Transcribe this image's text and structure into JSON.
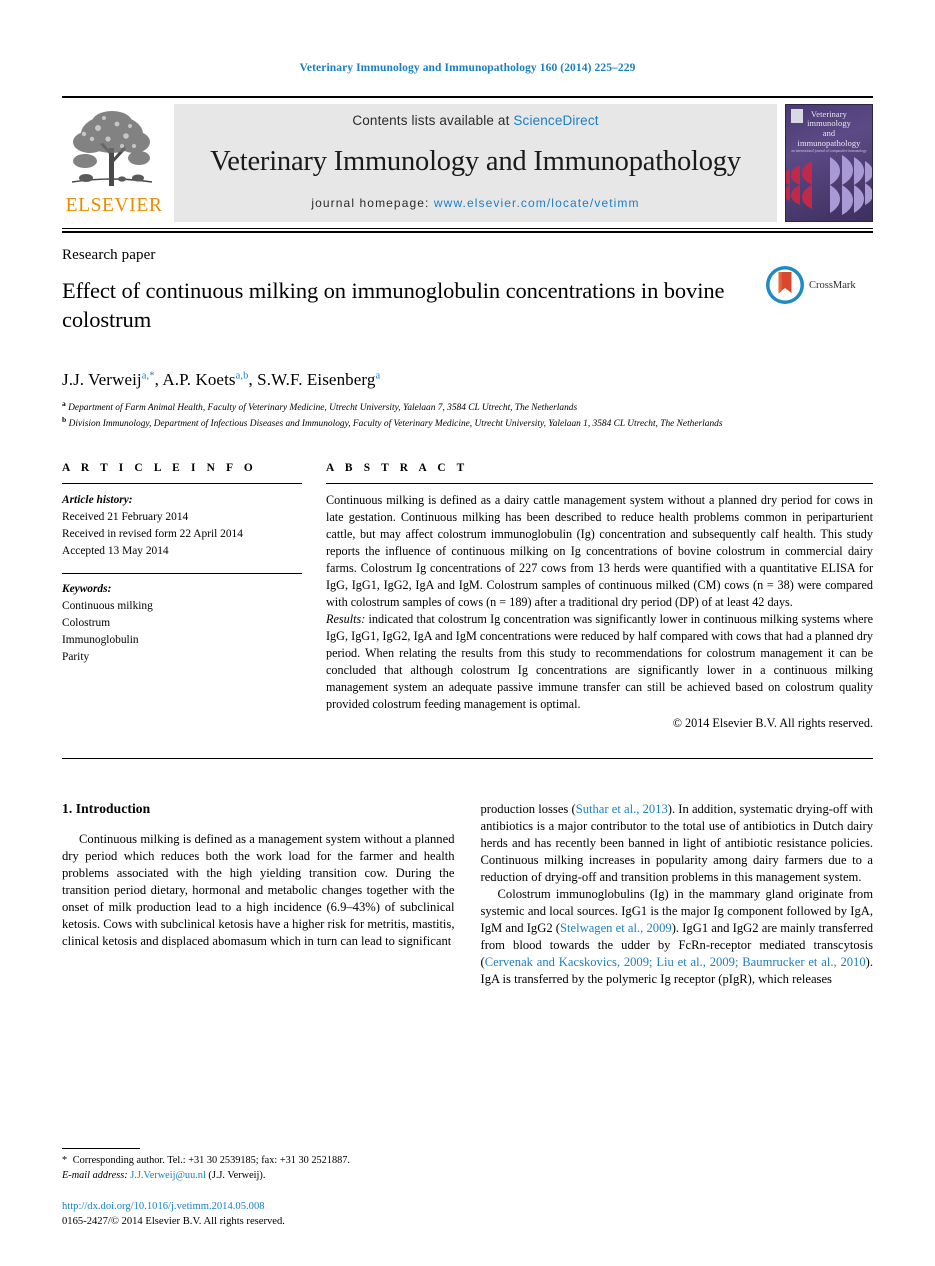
{
  "running_head": "Veterinary Immunology and Immunopathology 160 (2014) 225–229",
  "masthead": {
    "publisher": "ELSEVIER",
    "contents_prefix": "Contents lists available at ",
    "contents_link": "ScienceDirect",
    "journal_title": "Veterinary Immunology and Immunopathology",
    "homepage_prefix": "journal homepage: ",
    "homepage_url": "www.elsevier.com/locate/vetimm",
    "cover": {
      "line1": "Veterinary",
      "line2": "immunology",
      "line3": "and",
      "line4": "immunopathology",
      "subtitle": "an international journal of comparative immunology"
    }
  },
  "article": {
    "type": "Research paper",
    "title": "Effect of continuous milking on immunoglobulin concentrations in bovine colostrum",
    "crossmark_label": "CrossMark",
    "authors_html": "J.J. Verweij<sup>a,*</sup>, A.P. Koets<sup>a,b</sup>, S.W.F. Eisenberg<sup>a</sup>",
    "affiliation_a": "Department of Farm Animal Health, Faculty of Veterinary Medicine, Utrecht University, Yalelaan 7, 3584 CL Utrecht, The Netherlands",
    "affiliation_b": "Division Immunology, Department of Infectious Diseases and Immunology, Faculty of Veterinary Medicine, Utrecht University, Yalelaan 1, 3584 CL Utrecht, The Netherlands"
  },
  "article_info": {
    "heading": "A R T I C L E   I N F O",
    "history_label": "Article history:",
    "received": "Received 21 February 2014",
    "revised": "Received in revised form 22 April 2014",
    "accepted": "Accepted 13 May 2014",
    "keywords_label": "Keywords:",
    "keywords": [
      "Continuous milking",
      "Colostrum",
      "Immunoglobulin",
      "Parity"
    ]
  },
  "abstract": {
    "heading": "A B S T R A C T",
    "paragraph1": "Continuous milking is defined as a dairy cattle management system without a planned dry period for cows in late gestation. Continuous milking has been described to reduce health problems common in periparturient cattle, but may affect colostrum immunoglobulin (Ig) concentration and subsequently calf health. This study reports the influence of continuous milking on Ig concentrations of bovine colostrum in commercial dairy farms. Colostrum Ig concentrations of 227 cows from 13 herds were quantified with a quantitative ELISA for IgG, IgG1, IgG2, IgA and IgM. Colostrum samples of continuous milked (CM) cows (n = 38) were compared with colostrum samples of cows (n = 189) after a traditional dry period (DP) of at least 42 days.",
    "results_label": "Results:",
    "paragraph2": " indicated that colostrum Ig concentration was significantly lower in continuous milking systems where IgG, IgG1, IgG2, IgA and IgM concentrations were reduced by half compared with cows that had a planned dry period. When relating the results from this study to recommendations for colostrum management it can be concluded that although colostrum Ig concentrations are significantly lower in a continuous milking management system an adequate passive immune transfer can still be achieved based on colostrum quality provided colostrum feeding management is optimal.",
    "copyright": "© 2014 Elsevier B.V. All rights reserved."
  },
  "body": {
    "section_number_title": "1.  Introduction",
    "left_para1": "Continuous milking is defined as a management system without a planned dry period which reduces both the work load for the farmer and health problems associated with the high yielding transition cow. During the transition period dietary, hormonal and metabolic changes together with the onset of milk production lead to a high incidence (6.9–43%) of subclinical ketosis. Cows with subclinical ketosis have a higher risk for metritis, mastitis, clinical ketosis and displaced abomasum which in turn can lead to significant",
    "right_para1_pre": "production losses (",
    "right_para1_cite": "Suthar et al., 2013",
    "right_para1_post": "). In addition, systematic drying-off with antibiotics is a major contributor to the total use of antibiotics in Dutch dairy herds and has recently been banned in light of antibiotic resistance policies. Continuous milking increases in popularity among dairy farmers due to a reduction of drying-off and transition problems in this management system.",
    "right_para2_a": "Colostrum immunoglobulins (Ig) in the mammary gland originate from systemic and local sources. IgG1 is the major Ig component followed by IgA, IgM and IgG2 (",
    "right_para2_cite1": "Stelwagen et al., 2009",
    "right_para2_b": "). IgG1 and IgG2 are mainly transferred from blood towards the udder by FcRn-receptor mediated transcytosis (",
    "right_para2_cite2": "Cervenak and Kacskovics, 2009; Liu et al., 2009; Baumrucker et al., 2010",
    "right_para2_c": "). IgA is transferred by the polymeric Ig receptor (pIgR), which releases"
  },
  "footnotes": {
    "corresponding": "Corresponding author. Tel.: +31 30 2539185; fax: +31 30 2521887.",
    "email_label": "E-mail address:",
    "email": "J.J.Verweij@uu.nl",
    "email_suffix": "(J.J. Verweij).",
    "doi": "http://dx.doi.org/10.1016/j.vetimm.2014.05.008",
    "issn": "0165-2427/© 2014 Elsevier B.V. All rights reserved."
  },
  "colors": {
    "link": "#1b7fc4",
    "elsevier_orange": "#ed8b00",
    "masthead_bg": "#e7e7e8",
    "cover_purple": "#4a3a72",
    "cover_red": "#c0294a"
  }
}
